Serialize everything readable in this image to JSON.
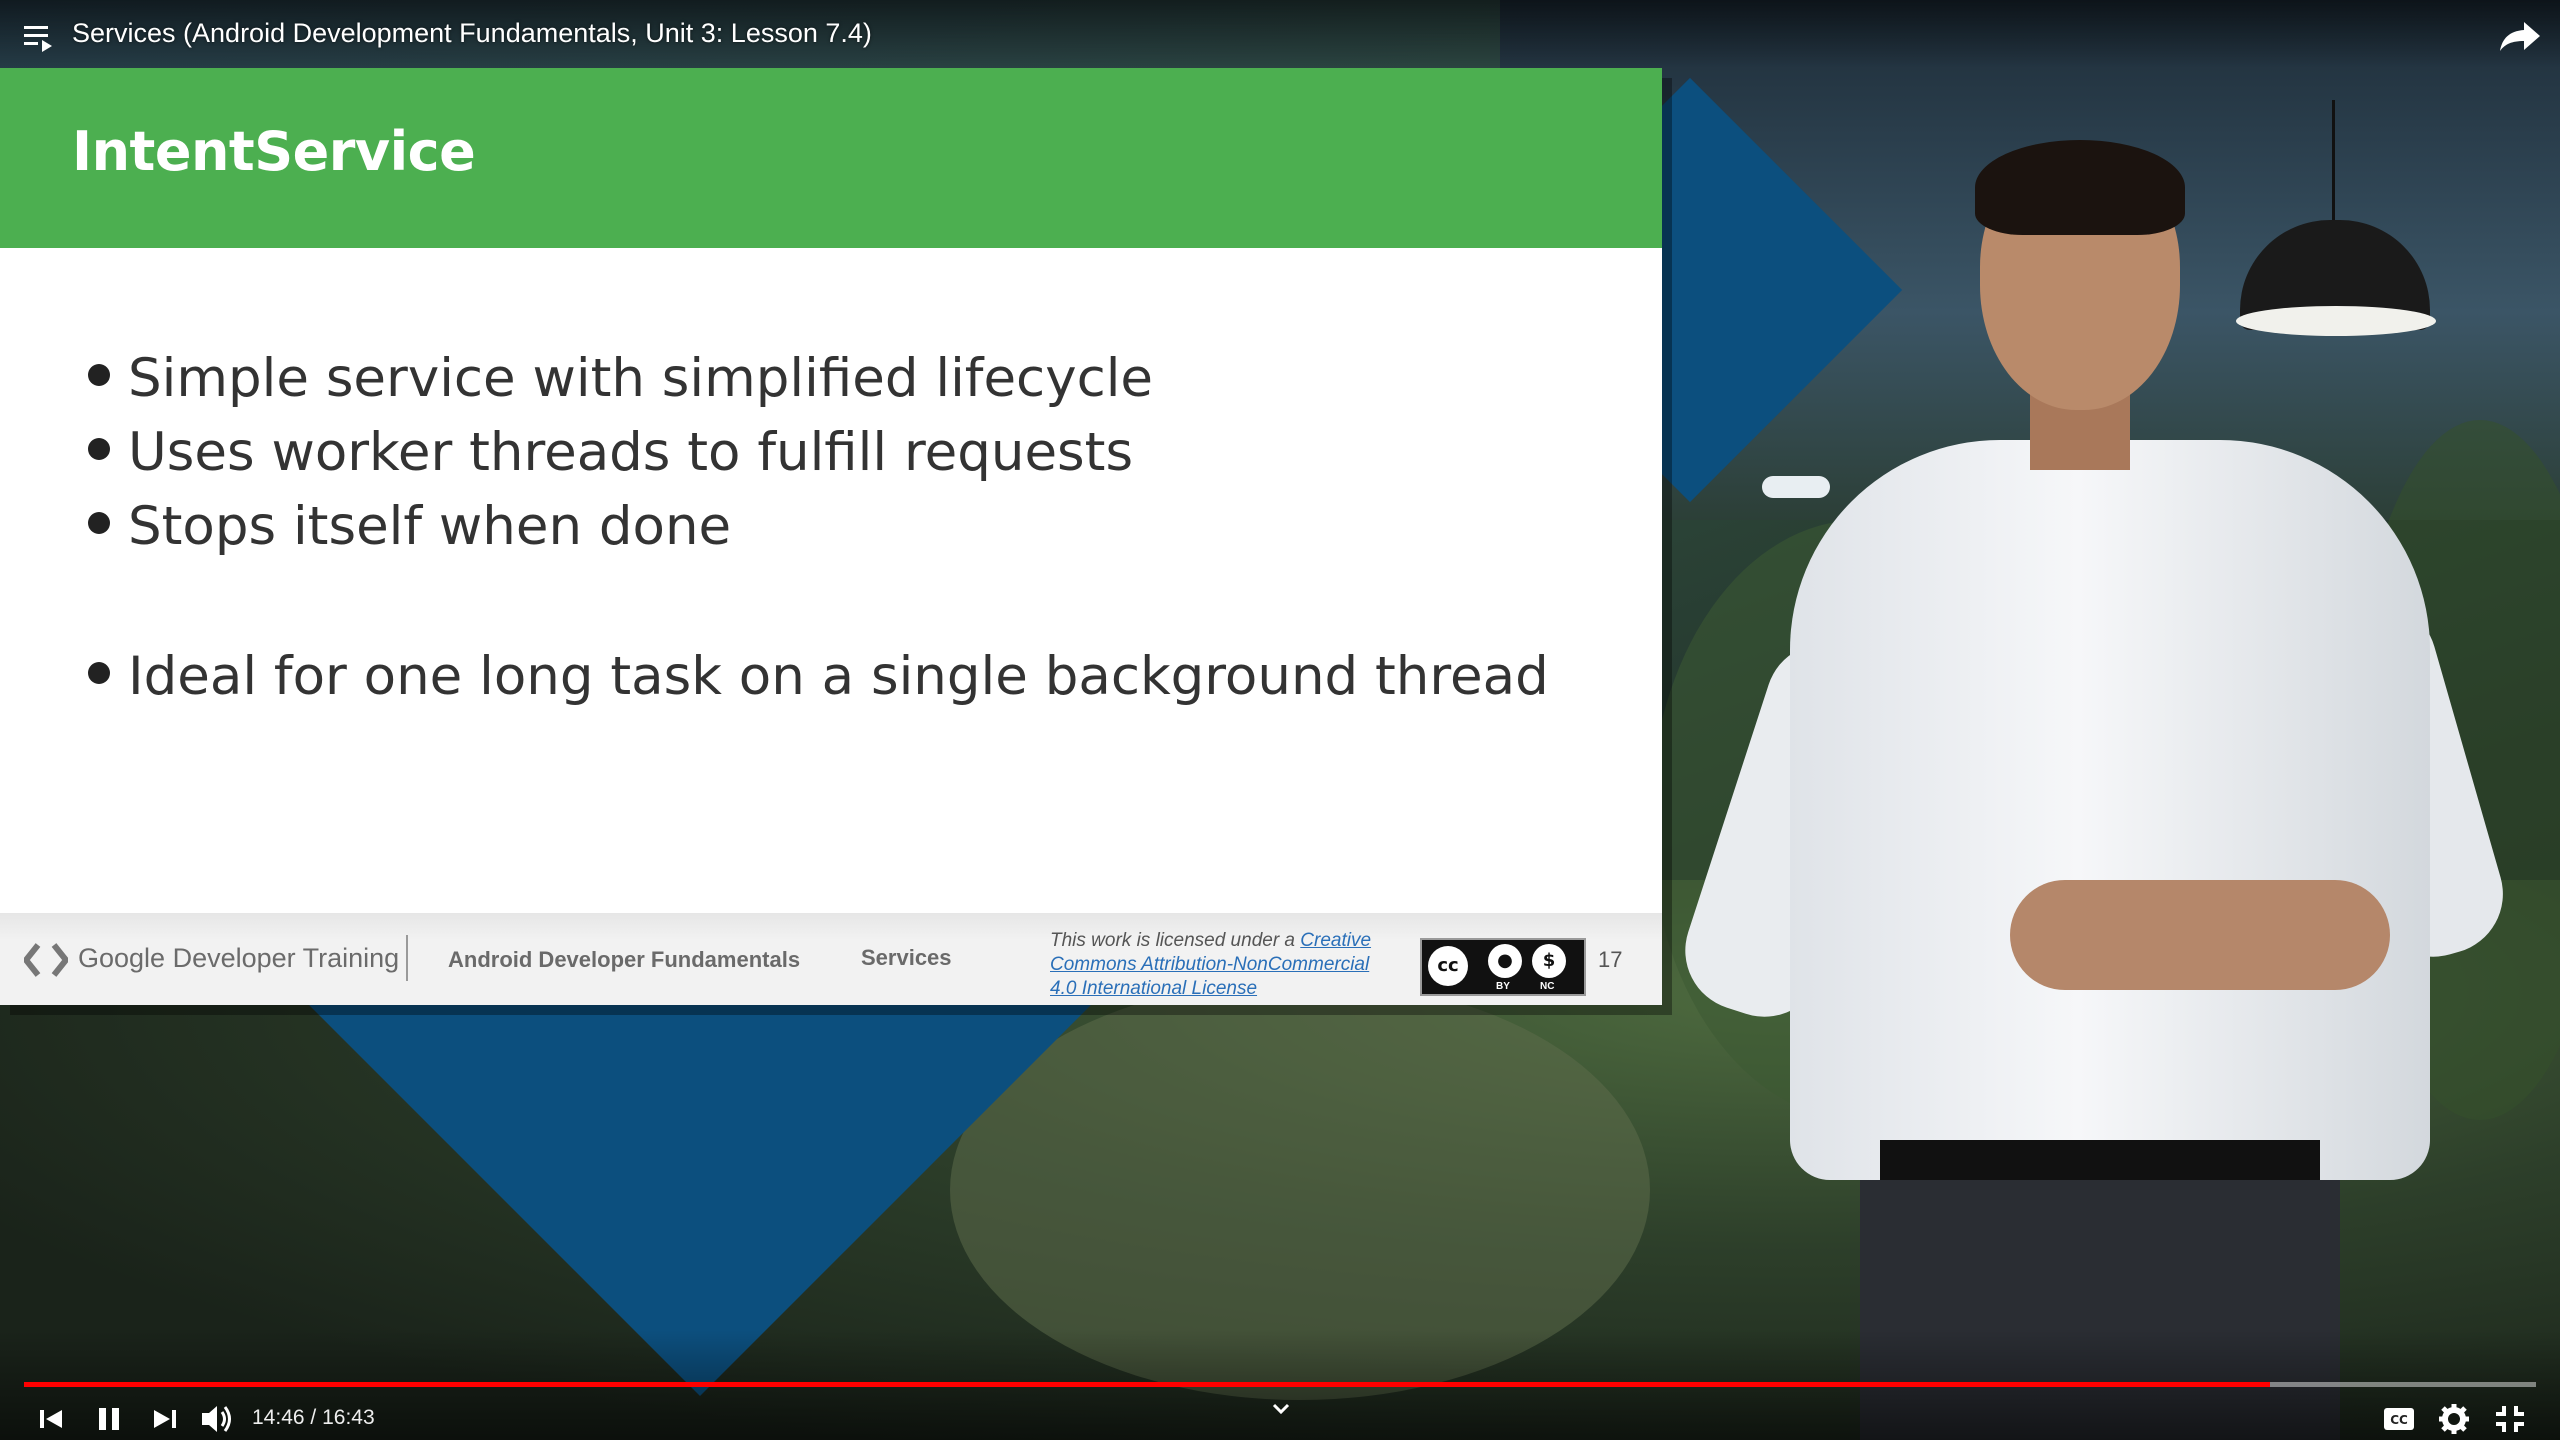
{
  "player": {
    "title": "Services (Android Development Fundamentals, Unit 3: Lesson 7.4)",
    "current_time": "14:46",
    "separator": "/",
    "duration": "16:43",
    "progress_fraction": 0.894,
    "accent_color": "#ff0000",
    "icons": {
      "playlist": "playlist-icon",
      "share": "share-icon",
      "previous": "skip-previous-icon",
      "pause": "pause-icon",
      "next": "skip-next-icon",
      "volume": "volume-icon",
      "chevron": "chevron-down-icon",
      "captions": "captions-icon",
      "settings": "gear-icon",
      "exit_fullscreen": "exit-fullscreen-icon"
    }
  },
  "slide": {
    "title": "IntentService",
    "header_color": "#4caf50",
    "bullets": [
      "Simple service with simplified lifecycle",
      "Uses worker threads to fulfill requests",
      "Stops itself when done",
      "Ideal for one long task on a single background thread"
    ],
    "footer": {
      "brand": "Google Developer Training",
      "course": "Android Developer Fundamentals",
      "topic": "Services",
      "license_prefix": "This work is licensed under a ",
      "license_link_line1": "Creative",
      "license_link_line2": "Commons Attribution-NonCommercial",
      "license_link_line3": "4.0 International License",
      "cc_labels": [
        "BY",
        "NC"
      ],
      "page_number": "17"
    }
  }
}
